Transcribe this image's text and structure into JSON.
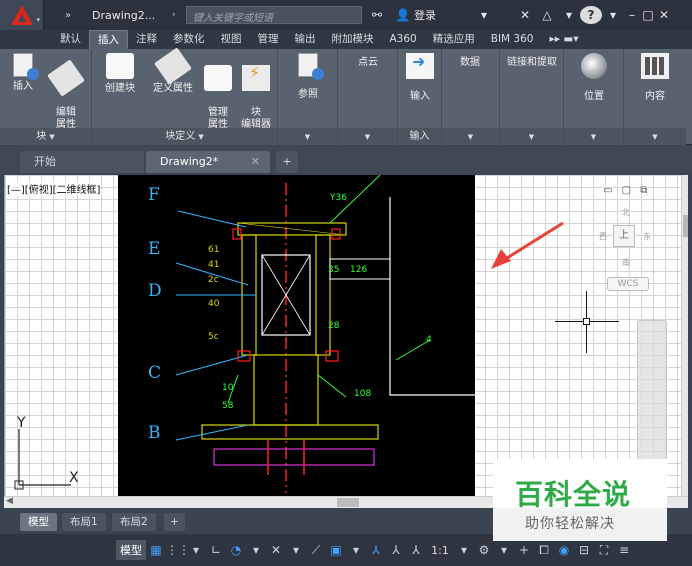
{
  "titlebar": {
    "app_name": "Drawing2...",
    "search_placeholder": "键入关键字或短语",
    "login": "登录"
  },
  "ribbon_tabs": [
    "默认",
    "插入",
    "注释",
    "参数化",
    "视图",
    "管理",
    "输出",
    "附加模块",
    "A360",
    "精选应用",
    "BIM 360"
  ],
  "ribbon": {
    "insert": "插入",
    "edit_attr": "编辑\n属性",
    "group_block": "块",
    "create_block": "创建块",
    "define_attr": "定义属性",
    "manage_attr": "管理\n属性",
    "block_editor": "块\n编辑器",
    "group_block_def": "块定义",
    "reference": "参照",
    "point_cloud": "点云",
    "import": "输入",
    "group_import": "输入",
    "data": "数据",
    "link_extract": "链接和提取",
    "location": "位置",
    "content": "内容"
  },
  "doc_tabs": {
    "start": "开始",
    "drawing": "Drawing2*"
  },
  "viewport": {
    "label": "[—][俯视][二维线框]",
    "viewcube": {
      "north": "北",
      "south": "南",
      "east": "东",
      "west": "西",
      "top": "上",
      "wcs": "WCS"
    },
    "ucs": {
      "x": "X",
      "y": "Y"
    }
  },
  "drawing_labels": {
    "F": "F",
    "E": "E",
    "D": "D",
    "C": "C",
    "B": "B",
    "n36": "Y36",
    "n35": "35",
    "n126": "126",
    "n61": "61",
    "n41": "41",
    "n2c": "2c",
    "n40": "40",
    "n5c": "5c",
    "n58": "58",
    "n108": "108",
    "n28": "28",
    "n10": "10",
    "n4": "4"
  },
  "layout_tabs": [
    "模型",
    "布局1",
    "布局2"
  ],
  "statusbar": {
    "model": "模型",
    "scale": "1:1"
  },
  "watermark": {
    "title": "百科全说",
    "subtitle": "助你轻松解决"
  },
  "colors": {
    "cyan": "#35b6ff",
    "yellow": "#d8d800",
    "red": "#ff2020",
    "green": "#33ff33",
    "magenta": "#ff40ff"
  }
}
